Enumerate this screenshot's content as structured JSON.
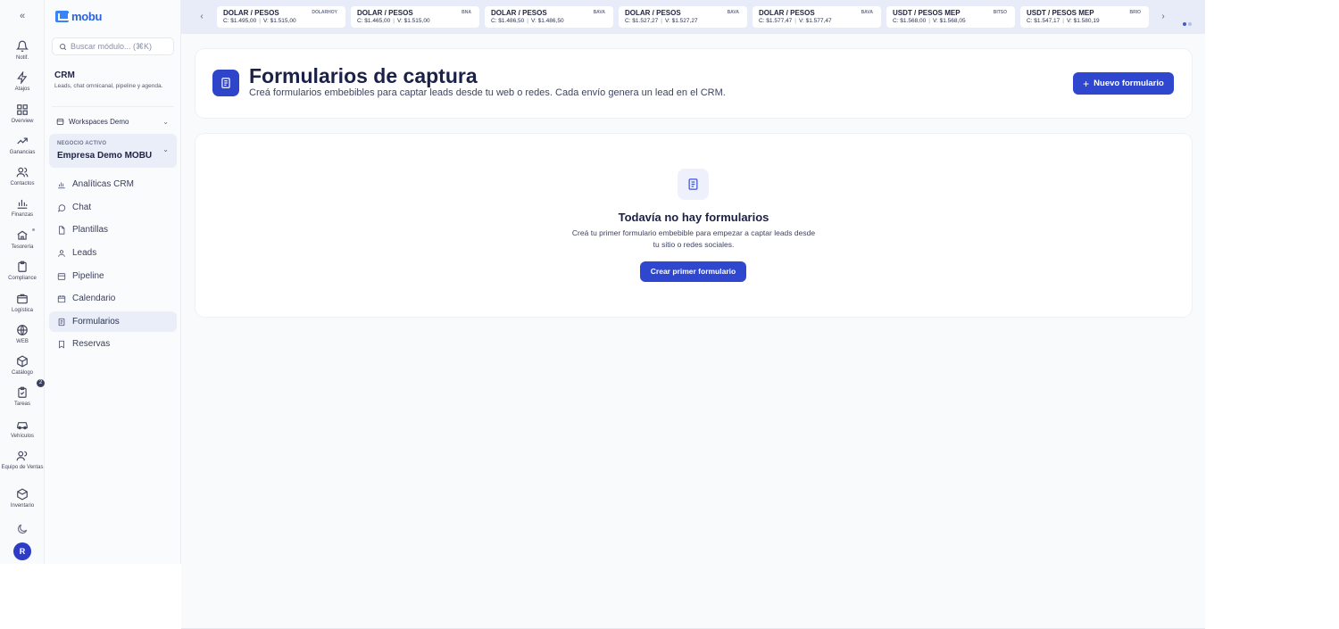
{
  "rail": {
    "items": [
      {
        "label": "Notif.",
        "icon": "bell-icon"
      },
      {
        "label": "Atajos",
        "icon": "zap-icon"
      },
      {
        "label": "Overview",
        "icon": "grid-icon"
      },
      {
        "label": "Ganancias",
        "icon": "trend-icon"
      },
      {
        "label": "Contactos",
        "icon": "users-icon"
      },
      {
        "label": "Finanzas",
        "icon": "bar-chart-icon"
      },
      {
        "label": "Tesorería",
        "icon": "bank-icon"
      },
      {
        "label": "Compliance",
        "icon": "clipboard-icon"
      },
      {
        "label": "Logística",
        "icon": "box-icon"
      },
      {
        "label": "WEB",
        "icon": "globe-icon"
      },
      {
        "label": "Catálogo",
        "icon": "package-icon"
      },
      {
        "label": "Tareas",
        "icon": "clipboard-check-icon"
      },
      {
        "label": "Vehículos",
        "icon": "car-icon"
      },
      {
        "label": "Equipo de Ventas",
        "icon": "team-icon"
      },
      {
        "label": "Inventario",
        "icon": "cube-icon"
      }
    ],
    "tasks_badge": "2",
    "avatar_initial": "R"
  },
  "sidebar": {
    "logo_text": "mobu",
    "search_placeholder": "Buscar módulo... (⌘K)",
    "module_title": "CRM",
    "module_description": "Leads, chat omnicanal, pipeline y agenda.",
    "workspace_label": "Workspaces Demo",
    "business_caption": "NEGOCIO ACTIVO",
    "business_name": "Empresa Demo MOBU",
    "nav": [
      {
        "label": "Analíticas CRM",
        "icon": "analytics-icon"
      },
      {
        "label": "Chat",
        "icon": "chat-icon"
      },
      {
        "label": "Plantillas",
        "icon": "file-icon"
      },
      {
        "label": "Leads",
        "icon": "user-icon"
      },
      {
        "label": "Pipeline",
        "icon": "layers-icon"
      },
      {
        "label": "Calendario",
        "icon": "calendar-icon"
      },
      {
        "label": "Formularios",
        "icon": "form-icon"
      },
      {
        "label": "Reservas",
        "icon": "bookmark-icon"
      }
    ],
    "active_nav": "Formularios"
  },
  "ticker": {
    "cards": [
      {
        "title": "DOLAR / PESOS",
        "source": "DOLARHOY",
        "buy": "C: $1.495,00",
        "sell": "V: $1.515,00"
      },
      {
        "title": "DOLAR / PESOS",
        "source": "BNA",
        "buy": "C: $1.465,00",
        "sell": "V: $1.515,00"
      },
      {
        "title": "DOLAR / PESOS",
        "source": "BAVA",
        "buy": "C: $1.486,50",
        "sell": "V: $1.486,50"
      },
      {
        "title": "DOLAR / PESOS",
        "source": "BAVA",
        "buy": "C: $1.527,27",
        "sell": "V: $1.527,27"
      },
      {
        "title": "DOLAR / PESOS",
        "source": "BAVA",
        "buy": "C: $1.577,47",
        "sell": "V: $1.577,47"
      },
      {
        "title": "USDT / PESOS MEP",
        "source": "BITSO",
        "buy": "C: $1.568,00",
        "sell": "V: $1.568,05"
      },
      {
        "title": "USDT / PESOS MEP",
        "source": "BRIO",
        "buy": "C: $1.547,17",
        "sell": "V: $1.580,19"
      }
    ]
  },
  "main": {
    "title": "Formularios de captura",
    "subtitle": "Creá formularios embebibles para captar leads desde tu web o redes. Cada envío genera un lead en el CRM.",
    "new_button": "Nuevo formulario",
    "empty_title": "Todavía no hay formularios",
    "empty_description": "Creá tu primer formulario embebible para empezar a captar leads desde tu sitio o redes sociales.",
    "create_button": "Crear primer formulario"
  },
  "colors": {
    "accent": "#2f47cf",
    "ticker_bg": "#e8ecf8",
    "active_nav_bg": "#e9eef9"
  }
}
